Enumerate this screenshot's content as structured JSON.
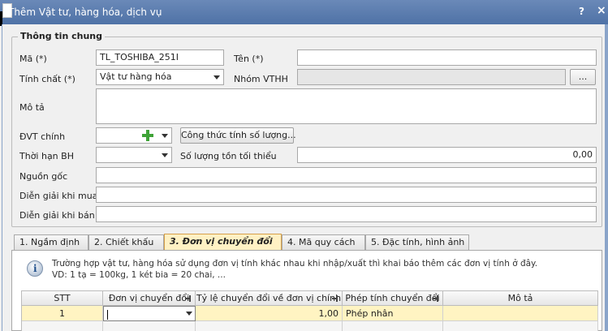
{
  "window": {
    "title": "Thêm Vật tư, hàng hóa, dịch vụ",
    "help_label": "?",
    "close_label": "×"
  },
  "general": {
    "legend": "Thông tin chung",
    "ma_label": "Mã (*)",
    "ma_value": "TL_TOSHIBA_251I",
    "ten_label": "Tên (*)",
    "ten_value": "",
    "tinh_chat_label": "Tính chất (*)",
    "tinh_chat_value": "Vật tư hàng hóa",
    "nhom_label": "Nhóm VTHH",
    "nhom_value": "",
    "nhom_button": "...",
    "mo_ta_label": "Mô tả",
    "mo_ta_value": "",
    "dvt_label": "ĐVT chính",
    "dvt_value": "",
    "cong_thuc_button": "Công thức tính số lượng...",
    "bh_label": "Thời hạn BH",
    "bh_value": "",
    "sl_toi_thieu_label": "Số lượng tồn tối thiểu",
    "sl_toi_thieu_value": "0,00",
    "nguon_goc_label": "Nguồn gốc",
    "nguon_goc_value": "",
    "dien_giai_mua_label": "Diễn giải khi mua",
    "dien_giai_mua_value": "",
    "dien_giai_ban_label": "Diễn giải khi bán",
    "dien_giai_ban_value": ""
  },
  "tabs": [
    {
      "label": "1. Ngầm định",
      "active": false
    },
    {
      "label": "2. Chiết khấu",
      "active": false
    },
    {
      "label": "3. Đơn vị chuyển đổi",
      "active": true
    },
    {
      "label": "4. Mã quy cách",
      "active": false
    },
    {
      "label": "5. Đặc tính, hình ảnh",
      "active": false
    }
  ],
  "info": {
    "line1": "Trường hợp vật tư, hàng hóa sử dụng đơn vị tính khác nhau khi nhập/xuất thì khai báo thêm các đơn vị tính ở đây.",
    "line2": "VD: 1 tạ = 100kg, 1 két bia = 20 chai, ..."
  },
  "grid": {
    "columns": [
      "STT",
      "Đơn vị chuyển đổi",
      "Tỷ lệ chuyển đổi về đơn vị chính",
      "Phép tính chuyển đổi",
      "Mô tả"
    ],
    "rows": [
      {
        "stt": "1",
        "don_vi": "",
        "ty_le": "1,00",
        "phep_tinh": "Phép nhân",
        "mo_ta": ""
      },
      {
        "stt": "",
        "don_vi": "",
        "ty_le": "",
        "phep_tinh": "",
        "mo_ta": ""
      }
    ]
  },
  "colors": {
    "titlebar": "#5a7bb0",
    "active_tab": "#fff1c4",
    "selected_row": "#fff4c2",
    "plus_icon": "#3fa337"
  }
}
